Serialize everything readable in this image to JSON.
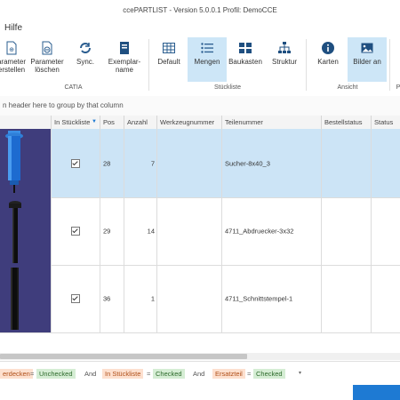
{
  "window": {
    "title": "ccePARTLIST - Version 5.0.0.1 Profil: DemoCCE"
  },
  "menu": {
    "hilfe": "Hilfe"
  },
  "ribbon": {
    "catia": {
      "group_label": "CATIA",
      "buttons": [
        {
          "label": "Parameter erstellen",
          "display": "arameter\nerstellen",
          "icon": "parameter-create-icon"
        },
        {
          "label": "Parameter löschen",
          "display": "Parameter\nlöschen",
          "icon": "parameter-delete-icon"
        },
        {
          "label": "Sync.",
          "display": "Sync.",
          "icon": "sync-icon"
        },
        {
          "label": "Exemplarname",
          "display": "Exemplar-\nname",
          "icon": "instance-name-icon"
        }
      ]
    },
    "stueckliste": {
      "group_label": "Stückliste",
      "buttons": [
        {
          "label": "Default",
          "icon": "table-grid-icon"
        },
        {
          "label": "Mengen",
          "icon": "list-icon",
          "selected": true
        },
        {
          "label": "Baukasten",
          "icon": "blocks-icon"
        },
        {
          "label": "Struktur",
          "icon": "tree-icon"
        }
      ]
    },
    "ansicht": {
      "group_label": "Ansicht",
      "buttons": [
        {
          "label": "Karten",
          "icon": "info-icon"
        },
        {
          "label": "Bilder an",
          "icon": "image-icon",
          "selected": true
        }
      ]
    }
  },
  "grid": {
    "group_hint": "n header here to group by that column",
    "columns": [
      "In Stückliste",
      "Pos",
      "Anzahl",
      "Werkzeugnummer",
      "Teilenummer",
      "Bestellstatus",
      "Status"
    ],
    "rows": [
      {
        "in_stueckliste": true,
        "pos": "28",
        "anzahl": "7",
        "werkzeugnummer": "",
        "teilenummer": "Sucher-8x40_3",
        "selected": true,
        "thumb": "blue-pin"
      },
      {
        "in_stueckliste": true,
        "pos": "29",
        "anzahl": "14",
        "werkzeugnummer": "",
        "teilenummer": "4711_Abdruecker-3x32",
        "selected": false,
        "thumb": "black-pin"
      },
      {
        "in_stueckliste": true,
        "pos": "36",
        "anzahl": "1",
        "werkzeugnummer": "",
        "teilenummer": "4711_Schnittstempel-1",
        "selected": false,
        "thumb": "black-punch"
      }
    ]
  },
  "filter": {
    "f1_field": "erdecken",
    "f1_op": "=",
    "f1_value": "Unchecked",
    "and1": "And",
    "f2_field": "In Stückliste",
    "f2_op": "=",
    "f2_value": "Checked",
    "and2": "And",
    "f3_field": "Ersatzteil",
    "f3_op": "=",
    "f3_value": "Checked"
  },
  "colors": {
    "accent": "#1e7ad3",
    "selected_row": "#cce4f6",
    "ribbon_selected": "#cde6f7",
    "thumb_bg": "#3f3d7c"
  }
}
